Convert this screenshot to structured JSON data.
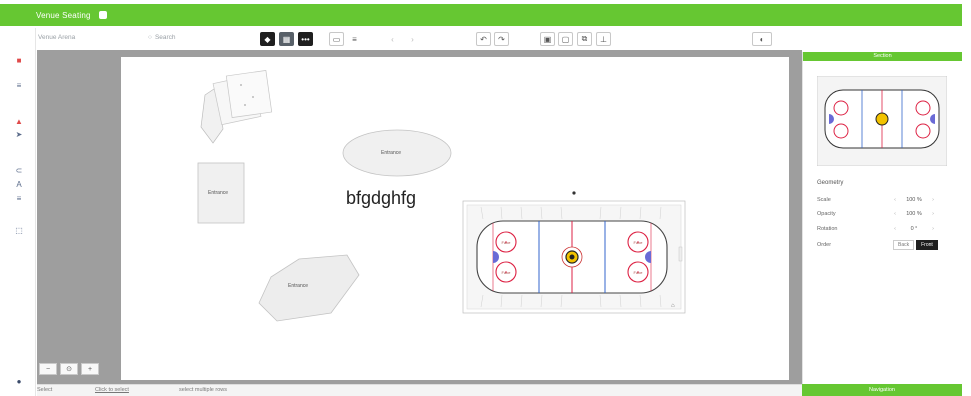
{
  "app": {
    "title": "Venue Seating",
    "accent": "#66c732"
  },
  "toolbar": {
    "venue_name": "Venue Arena",
    "search_label": "Search",
    "icons": [
      "tag-icon",
      "grid-icon",
      "ellipsis-icon",
      "align-left-icon",
      "align-center-icon",
      "arrow-left-icon",
      "arrow-right-icon",
      "undo-icon",
      "redo-icon",
      "copy-icon",
      "paste-icon",
      "duplicate-icon",
      "delete-icon",
      "preview-icon"
    ]
  },
  "leftbar": {
    "icons": [
      "settings-icon",
      "shape-icon",
      "menu-icon",
      "pin-icon",
      "pointer-icon",
      "link-icon",
      "text-icon",
      "layers-icon",
      "select-icon",
      "help-icon"
    ]
  },
  "canvas": {
    "shapes": {
      "fan_label": "",
      "rect_label": "Entrance",
      "ellipse_label": "Entrance",
      "pentagon_label": "Entrance"
    },
    "text_object": "bfgdghfg",
    "rink_faceoff_labels": [
      "Face",
      "Face",
      "Face",
      "Face"
    ]
  },
  "zoom": {
    "minus": "−",
    "reset": "⊙",
    "plus": "+"
  },
  "status": {
    "mode": "Select",
    "hint": "Click to select",
    "multi": "select multiple rows"
  },
  "rpanel": {
    "header": "Section",
    "section_title": "Geometry",
    "rows": [
      {
        "label": "Scale",
        "value": "100 %"
      },
      {
        "label": "Opacity",
        "value": "100 %"
      },
      {
        "label": "Rotation",
        "value": "0 °"
      }
    ],
    "order_label": "Order",
    "order_options": [
      "Back",
      "Front"
    ],
    "footer": "Navigation"
  }
}
